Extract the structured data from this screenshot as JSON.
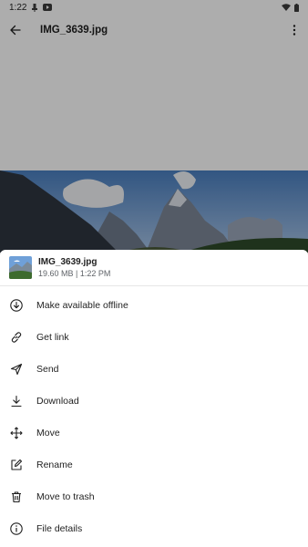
{
  "status_bar": {
    "time": "1:22"
  },
  "header": {
    "title": "IMG_3639.jpg",
    "back_icon": "arrow-back-icon",
    "more_icon": "more-vert-icon"
  },
  "sheet": {
    "file_name": "IMG_3639.jpg",
    "file_meta": "19.60 MB | 1:22 PM",
    "items": [
      {
        "label": "Make available offline",
        "icon": "offline-download-icon"
      },
      {
        "label": "Get link",
        "icon": "link-icon"
      },
      {
        "label": "Send",
        "icon": "send-icon"
      },
      {
        "label": "Download",
        "icon": "download-icon"
      },
      {
        "label": "Move",
        "icon": "move-icon"
      },
      {
        "label": "Rename",
        "icon": "rename-icon"
      },
      {
        "label": "Move to trash",
        "icon": "trash-icon"
      },
      {
        "label": "File details",
        "icon": "info-icon"
      }
    ]
  },
  "colors": {
    "text": "#1f1f1f",
    "secondary_text": "#5f6368",
    "scrim": "rgba(0,0,0,0.32)"
  }
}
